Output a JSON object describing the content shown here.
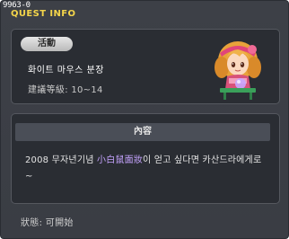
{
  "window": {
    "quest_id": "9963-0",
    "title": "QUEST INFO"
  },
  "quest": {
    "category_tag": "活動",
    "name": "화이트 마우스 분장",
    "level_label": "建議等級:",
    "level_range": "10~14"
  },
  "content": {
    "header": "內容",
    "text_before": "2008 무자년기념 ",
    "item_name": "小白鼠面妝",
    "text_after": "이 얻고 싶다면 카산드라에게로~"
  },
  "status": {
    "label": "狀態:",
    "value": "可開始"
  },
  "icons": {
    "npc": "npc-cassandra-portrait-icon"
  },
  "colors": {
    "title": "#f4d54a",
    "highlight": "#c6a4ff",
    "panel": "#2a2d33",
    "window": "#3d4047"
  }
}
